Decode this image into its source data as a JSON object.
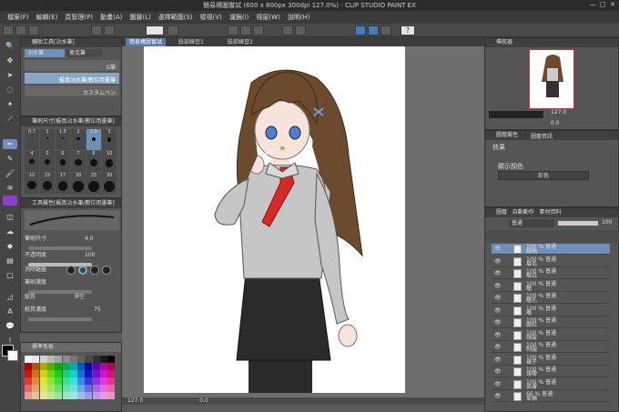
{
  "window": {
    "title": "簡易構圖嘗試 (600 x 800px 300dpi 127.0%) - CLIP STUDIO PAINT EX"
  },
  "menu": [
    "檔案(F)",
    "編輯(E)",
    "頁管理(P)",
    "動畫(A)",
    "圖層(L)",
    "選擇範圍(S)",
    "檢視(V)",
    "濾鏡(I)",
    "視窗(W)",
    "說明(H)"
  ],
  "panels": {
    "subtool": {
      "title": "輔助工具[沾水筆]",
      "tabs": [
        "沾水筆",
        "麥克筆"
      ],
      "items": [
        "G筆",
        "擬真G筆",
        "濃淡沾水筆/數位用畫筆",
        "自訂沾水筆",
        "擬真沾水筆/筆壓淡色",
        "更真實的G筆",
        "設計用",
        "丸ペン",
        "平滑的沾水筆",
        "刷筆",
        "漫畫用線條",
        "水彩筆1",
        "水彩筆2",
        "輪廓線/描繪強弱"
      ],
      "selected_label": "擬真沾水筆/數位用畫筆",
      "custom_label": "カスタムペン"
    },
    "brushsize": {
      "title": "筆刷尺寸[擬真沾水筆/數位用畫筆]",
      "sizes": [
        "0.7",
        "1",
        "1.5",
        "2",
        "2.5",
        "3",
        "4",
        "5",
        "6",
        "7",
        "8",
        "10",
        "12",
        "15",
        "17",
        "20",
        "25",
        "30"
      ]
    },
    "tooltip": {
      "title": "工具屬性[擬真沾水筆/數位用畫筆]",
      "brush_name": "擬真沾水筆/數位用畫筆",
      "size_label": "筆刷尺寸",
      "size_value": "4.0",
      "opacity_label": "不透明度",
      "opacity_value": "100",
      "aa_label": "消除鋸齒",
      "stab_label": "筆刷濃度",
      "texture_label": "紙質",
      "texture_value": "淨空",
      "paper_label": "紙質濃度",
      "paper_value": "75"
    },
    "color": {
      "title": "標準色板"
    },
    "navigator": {
      "title": "導航器",
      "zoom": "127.0",
      "angle": "0.0"
    },
    "layerprop": {
      "title": "圖層屬性",
      "tab2": "圖層資訊",
      "effect_label": "效果",
      "color_label": "顯示顏色",
      "color_value": "彩色"
    },
    "layers": {
      "title": "圖層",
      "tabs": [
        "圖層",
        "自動動作",
        "素材資料"
      ],
      "blend": "普通",
      "opacity": "100",
      "items": [
        {
          "pct": "100 %",
          "name": "普通",
          "sub": "線稿"
        },
        {
          "pct": "100 %",
          "name": "普通",
          "sub": "眉毛"
        },
        {
          "pct": "100 %",
          "name": "普通",
          "sub": "眼白"
        },
        {
          "pct": "100 %",
          "name": "普通",
          "sub": "瞳"
        },
        {
          "pct": "100 %",
          "name": "普通",
          "sub": "瞳孔"
        },
        {
          "pct": "100 %",
          "name": "普通",
          "sub": "嘴"
        },
        {
          "pct": "100 %",
          "name": "普通",
          "sub": "腮紅"
        },
        {
          "pct": "100 %",
          "name": "普通",
          "sub": "頭髮"
        },
        {
          "pct": "100 %",
          "name": "普通",
          "sub": "制服"
        },
        {
          "pct": "100 %",
          "name": "普通",
          "sub": "裙子"
        },
        {
          "pct": "100 %",
          "name": "普通",
          "sub": "領帶"
        },
        {
          "pct": "100 %",
          "name": "普通",
          "sub": "皮膚"
        },
        {
          "pct": "66 %",
          "name": "普通",
          "sub": "草稿"
        }
      ]
    }
  },
  "doc": {
    "tabs": [
      "簡易構圖嘗試",
      "臉部練習1",
      "臉部練習2"
    ]
  },
  "status": {
    "zoom": "127.0",
    "angle": "0.0"
  },
  "colors": {
    "accent": "#8a3fd1",
    "bg": "#5a5a5a",
    "header": "#3f3f3f"
  }
}
